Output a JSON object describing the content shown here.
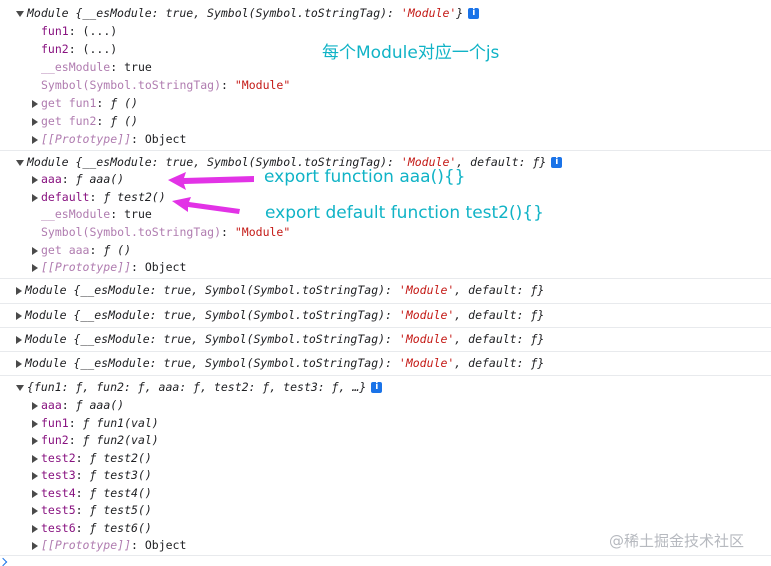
{
  "log1": {
    "header": {
      "prefix": "Module {__esModule: ",
      "v1": "true",
      "mid": ", Symbol(Symbol.toStringTag): ",
      "tag": "'Module'",
      "suffix": "}"
    },
    "rows": [
      {
        "key": "fun1",
        "value": ": (...)"
      },
      {
        "key": "fun2",
        "value": ": (...)"
      },
      {
        "key": "__esModule",
        "value": ": true"
      },
      {
        "key": "Symbol(Symbol.toStringTag)",
        "value": ": ",
        "str": "\"Module\""
      },
      {
        "key": "get fun1",
        "value": ": ",
        "f": "ƒ ()"
      },
      {
        "key": "get fun2",
        "value": ": ",
        "f": "ƒ ()"
      },
      {
        "key": "[[Prototype]]",
        "value": ": Object"
      }
    ]
  },
  "log2": {
    "header": {
      "prefix": "Module {__esModule: ",
      "v1": "true",
      "mid": ", Symbol(Symbol.toStringTag): ",
      "tag": "'Module'",
      "suffix": ", default: ƒ}"
    },
    "rows": [
      {
        "key": "aaa",
        "value": ": ",
        "f": "ƒ aaa()"
      },
      {
        "key": "default",
        "value": ": ",
        "f": "ƒ test2()"
      },
      {
        "key": "__esModule",
        "value": ": true"
      },
      {
        "key": "Symbol(Symbol.toStringTag)",
        "value": ": ",
        "str": "\"Module\""
      },
      {
        "key": "get aaa",
        "value": ": ",
        "f": "ƒ ()"
      },
      {
        "key": "[[Prototype]]",
        "value": ": Object"
      }
    ]
  },
  "collapsed": {
    "prefix": "Module {__esModule: ",
    "v1": "true",
    "mid": ", Symbol(Symbol.toStringTag): ",
    "tag": "'Module'",
    "suffix": ", default: ƒ}"
  },
  "log7": {
    "header": "{fun1: ƒ, fun2: ƒ, aaa: ƒ, test2: ƒ, test3: ƒ, …}",
    "rows": [
      {
        "key": "aaa",
        "f": "ƒ aaa()"
      },
      {
        "key": "fun1",
        "f": "ƒ fun1(val)"
      },
      {
        "key": "fun2",
        "f": "ƒ fun2(val)"
      },
      {
        "key": "test2",
        "f": "ƒ test2()"
      },
      {
        "key": "test3",
        "f": "ƒ test3()"
      },
      {
        "key": "test4",
        "f": "ƒ test4()"
      },
      {
        "key": "test5",
        "f": "ƒ test5()"
      },
      {
        "key": "test6",
        "f": "ƒ test6()"
      },
      {
        "key": "[[Prototype]]",
        "plain": ": Object"
      }
    ]
  },
  "annotations": {
    "a1": "每个Module对应一个js",
    "a2": "export function aaa(){}",
    "a3": "export default function test2(){}"
  },
  "watermark": "@稀土掘金技术社区",
  "colors": {
    "annotation": "#10b3c6",
    "arrow": "#e233e6",
    "info_badge": "#1a73e8"
  }
}
